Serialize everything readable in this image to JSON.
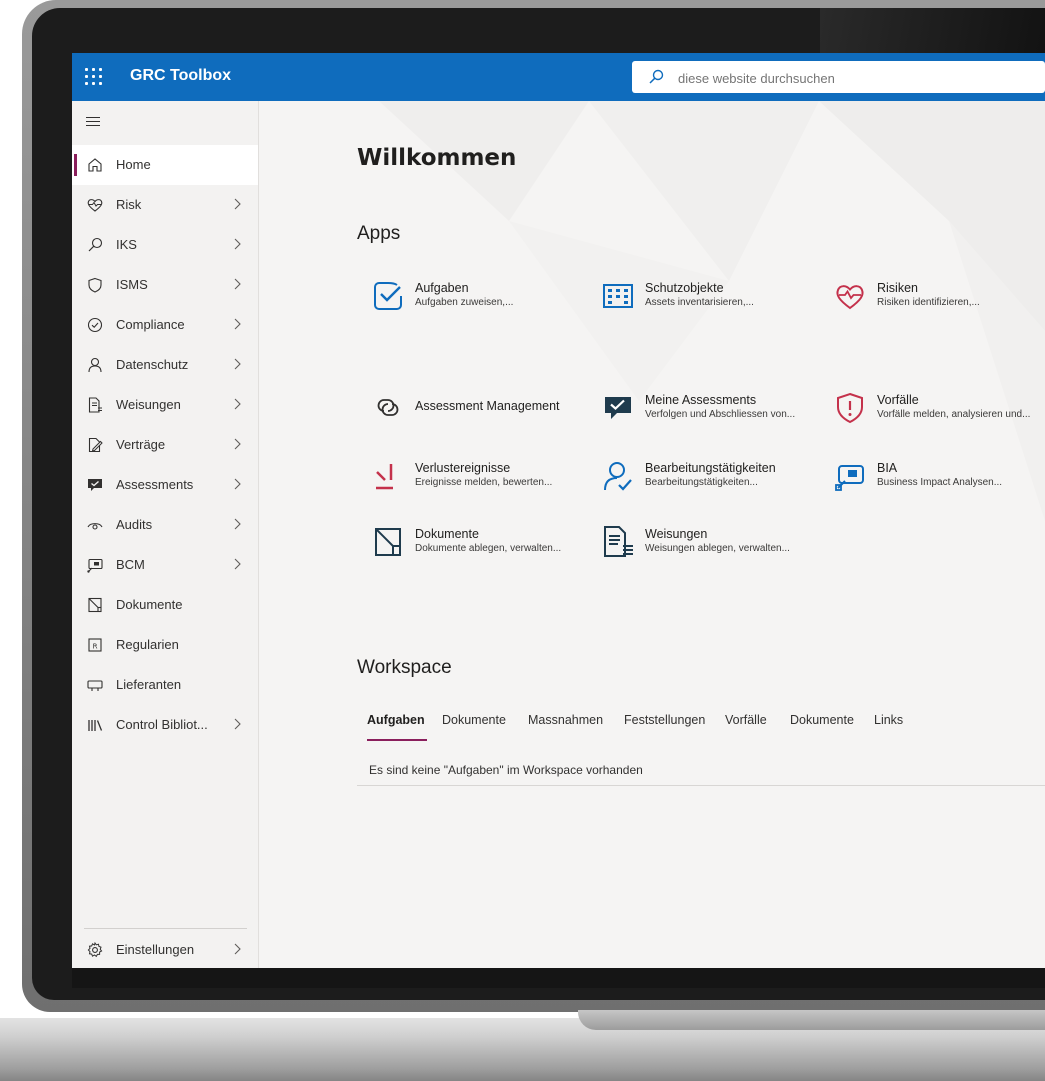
{
  "suite_bar": {
    "app_title": "GRC Toolbox",
    "search_placeholder": "diese website durchsuchen"
  },
  "sidebar": {
    "items": [
      {
        "label": "Home",
        "icon": "home-icon",
        "active": true,
        "has_chevron": false
      },
      {
        "label": "Risk",
        "icon": "heart-pulse-icon",
        "has_chevron": true
      },
      {
        "label": "IKS",
        "icon": "search-icon",
        "has_chevron": true
      },
      {
        "label": "ISMS",
        "icon": "shield-icon",
        "has_chevron": true
      },
      {
        "label": "Compliance",
        "icon": "check-circle-icon",
        "has_chevron": true
      },
      {
        "label": "Datenschutz",
        "icon": "person-icon",
        "has_chevron": true
      },
      {
        "label": "Weisungen",
        "icon": "document-list-icon",
        "has_chevron": true
      },
      {
        "label": "Verträge",
        "icon": "document-edit-icon",
        "has_chevron": true
      },
      {
        "label": "Assessments",
        "icon": "chat-check-icon",
        "has_chevron": true
      },
      {
        "label": "Audits",
        "icon": "eye-icon",
        "has_chevron": true
      },
      {
        "label": "BCM",
        "icon": "chart-board-icon",
        "has_chevron": true
      },
      {
        "label": "Dokumente",
        "icon": "document-icon",
        "has_chevron": false
      },
      {
        "label": "Regularien",
        "icon": "regulation-icon",
        "has_chevron": false
      },
      {
        "label": "Lieferanten",
        "icon": "truck-icon",
        "has_chevron": false
      },
      {
        "label": "Control Bibliot...",
        "icon": "library-icon",
        "has_chevron": true
      }
    ],
    "settings_label": "Einstellungen"
  },
  "main": {
    "welcome": "Willkommen",
    "apps_title": "Apps",
    "apps": [
      {
        "name": "Aufgaben",
        "desc": "Aufgaben zuweisen,...",
        "icon": "task-check-icon"
      },
      {
        "name": "Schutzobjekte",
        "desc": "Assets inventarisieren,...",
        "icon": "building-grid-icon"
      },
      {
        "name": "Risiken",
        "desc": "Risiken identifizieren,...",
        "icon": "heart-pulse-icon"
      },
      {
        "name": "Assessment Management",
        "desc": "",
        "icon": "link-icon"
      },
      {
        "name": "Meine Assessments",
        "desc": "Verfolgen und Abschliessen von...",
        "icon": "chat-check-icon"
      },
      {
        "name": "Vorfälle",
        "desc": "Vorfälle melden, analysieren und...",
        "icon": "shield-alert-icon"
      },
      {
        "name": "Verlustereignisse",
        "desc": "Ereignisse melden, bewerten...",
        "icon": "loss-event-icon"
      },
      {
        "name": "Bearbeitungstätigkeiten",
        "desc": "Bearbeitungstätigkeiten...",
        "icon": "person-check-icon"
      },
      {
        "name": "BIA",
        "desc": "Business Impact Analysen...",
        "icon": "chart-board-icon"
      },
      {
        "name": "Dokumente",
        "desc": "Dokumente ablegen, verwalten...",
        "icon": "document-icon"
      },
      {
        "name": "Weisungen",
        "desc": "Weisungen ablegen, verwalten...",
        "icon": "document-list-icon"
      }
    ],
    "workspace_title": "Workspace",
    "tabs": [
      "Aufgaben",
      "Dokumente",
      "Massnahmen",
      "Feststellungen",
      "Vorfälle",
      "Dokumente",
      "Links"
    ],
    "active_tab": "Aufgaben",
    "empty_message": "Es sind keine \"Aufgaben\" im Workspace vorhanden"
  },
  "colors": {
    "suite_bar": "#0f6cbd",
    "accent": "#8a1f5c",
    "icon_blue": "#0f6cbd",
    "icon_red": "#c4314b",
    "icon_dark": "#1f3b4d"
  }
}
